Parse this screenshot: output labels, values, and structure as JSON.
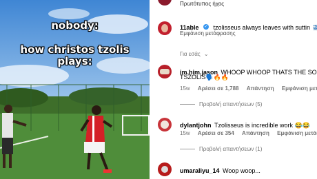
{
  "video": {
    "caption_line1": "nobody:",
    "caption_line2": "how christos tzolis",
    "caption_line3": "plays:"
  },
  "top_label": "Πρωτότυπος ήχος",
  "sort_label": "Για εσάς",
  "comments": [
    {
      "username": "11able",
      "verified": true,
      "text": "tzolisseus always leaves with suttin",
      "flag": "🇬🇷",
      "translate": "Εμφάνιση μετάφρασης"
    },
    {
      "username": "im.him.jason",
      "text_line1": "WHOOP WHOOP THATS THE SOUN",
      "text_line2": "TSZOLIS🗣️🔥🔥",
      "time": "15w",
      "likes": "Αρέσει σε 1,788",
      "reply": "Απάντηση",
      "translate": "Εμφάνιση μετάφρ",
      "view_replies": "Προβολή απαντήσεων (5)"
    },
    {
      "username": "dylantjohn",
      "text": "Tzolisseus is incredible work 😂😂",
      "time": "15w",
      "likes": "Αρέσει σε 354",
      "reply": "Απάντηση",
      "translate": "Εμφάνιση μετάφρασης",
      "view_replies": "Προβολή απαντήσεων (1)"
    },
    {
      "username": "umaraliyu_14",
      "text": "Woop woop..."
    }
  ]
}
